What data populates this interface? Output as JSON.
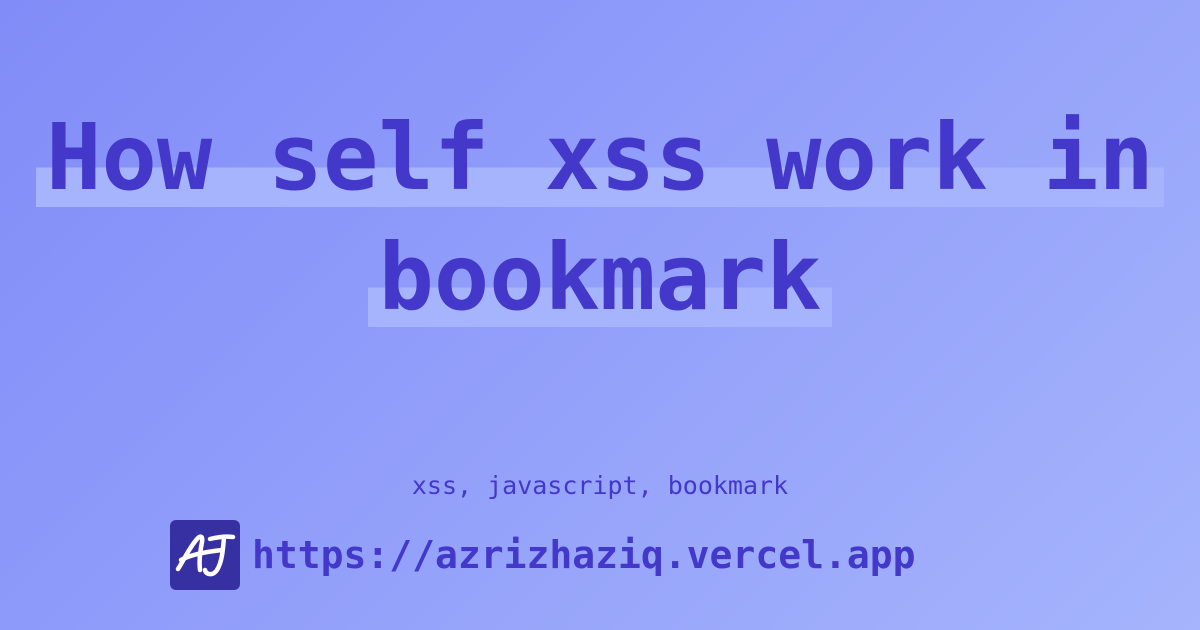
{
  "title": {
    "line1": "How self xss work in",
    "line2": "bookmark"
  },
  "tags": "xss, javascript, bookmark",
  "site": {
    "logo_text": "AJ",
    "logo_icon": "aj-monogram-icon",
    "url": "https://azrizhaziq.vercel.app"
  },
  "colors": {
    "background_start": "#818cf8",
    "background_end": "#a5b4fc",
    "text": "#4338ca",
    "highlight": "#a5b4fc",
    "logo_bg": "#3730a3"
  }
}
